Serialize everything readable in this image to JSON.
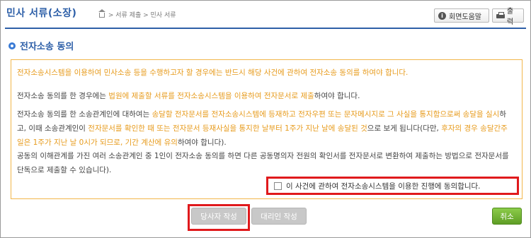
{
  "header": {
    "title": "민사 서류(소장)",
    "breadcrumb": "> 서류 제출 > 민사 서류",
    "help_button": "회면도움말",
    "print_button": "출력"
  },
  "section": {
    "title": "전자소송 동의"
  },
  "notice": {
    "p0": "전자소송시스템을 이용하여 민사소송 등을 수행하고자 할 경우에는 반드시 해당 사건에 관하여 전자소송 동의를 하여야 합니다.",
    "p1_a": "전자소송 동의를 한 경우에는 ",
    "p1_b": "법원에 제출할 서류를 전자소송시스템을 이용하여 전자문서로 제출",
    "p1_c": "하여야 합니다.",
    "p2_a": "전자소송 동의를 한 소송관계인에 대하여는 ",
    "p2_b": "송달할 전자문서를 전자소송시스템에 등재하고 전자우편 또는 문자메시지로 그 사실을 통지함으로써 송달을 실시",
    "p2_c": "하고, 이때 소송관계인이 ",
    "p2_d": "전자문서를 확인한 때 또는 전자문서 등재사실을 통지한 날부터 1주가 지난 날에 송달된 것",
    "p2_e": "으로 보게 됩니다(다만, ",
    "p2_f": "후자의 경우 송달간주일은 1주가 지난 날 0시가 되므로, 기간 계산에 유의",
    "p2_g": "하여야 합니다).",
    "p3": "공동의 이해관계를 가진 여러 소송관계인 중 1인이 전자소송 동의를 하면 다른 공동명의자 전원의 확인서를 전자문서로 변환하여 제출하는 방법으로 전자문서를 단독으로 제출할 수 있습니다)."
  },
  "consent": {
    "label": "이 사건에 관하여 전자소송시스템을 이용한 진행에 동의합니다.",
    "checked": false
  },
  "buttons": {
    "party": "당사자 작성",
    "proxy": "대리인 작성",
    "cancel": "취소"
  },
  "colors": {
    "accent": "#2d5fa8",
    "highlight": "#e79b1c",
    "outline": "#e0191c",
    "cancel": "#6aae2d"
  }
}
